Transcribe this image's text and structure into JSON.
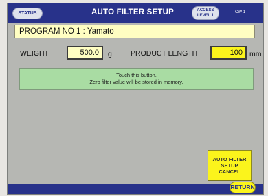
{
  "header": {
    "status_label": "STATUS",
    "title": "AUTO FILTER SETUP",
    "access_line1": "ACCESS",
    "access_line2": "LEVEL 1",
    "machine_id": "CW-1"
  },
  "program": {
    "label": "PROGRAM NO 1 : Yamato"
  },
  "weight": {
    "label": "WEIGHT",
    "value": "500.0",
    "unit": "g"
  },
  "product_length": {
    "label": "PRODUCT LENGTH",
    "value": "100",
    "unit": "mm"
  },
  "touch_button": {
    "line1": "Touch this button.",
    "line2": "Zero filter value will be stored in memory."
  },
  "cancel_button": {
    "line1": "AUTO FILTER",
    "line2": "SETUP",
    "line3": "CANCEL"
  },
  "footer": {
    "return_label": "RETURN"
  },
  "colors": {
    "header_blue": "#28328a",
    "panel_gray": "#b6b7b3",
    "input_cream": "#fffec2",
    "highlight_yellow": "#fbf41c",
    "touch_green": "#a9dca3"
  }
}
